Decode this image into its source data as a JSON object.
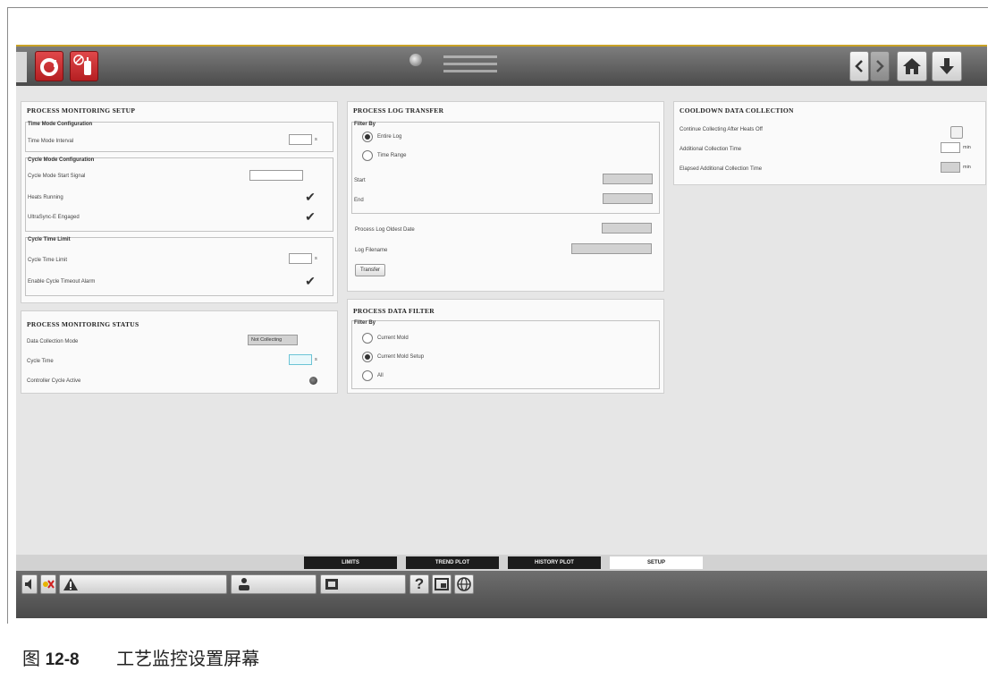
{
  "tabs": [
    "LIMITS",
    "TREND PLOT",
    "HISTORY PLOT",
    "SETUP"
  ],
  "active_tab": "SETUP",
  "setup": {
    "title": "PROCESS MONITORING SETUP",
    "time_mode_group": "Time Mode Configuration",
    "time_mode_interval_label": "Time Mode Interval",
    "time_mode_interval_unit": "s",
    "cycle_mode_group": "Cycle Mode Configuration",
    "cycle_mode_start_signal_label": "Cycle Mode Start Signal",
    "heats_running_label": "Heats Running",
    "ultrasync_label": "UltraSync-E Engaged",
    "cycle_time_limit_group": "Cycle Time Limit",
    "cycle_time_limit_label": "Cycle Time Limit",
    "cycle_time_limit_unit": "s",
    "cycle_timeout_alarm_label": "Enable Cycle Timeout Alarm"
  },
  "status": {
    "title": "PROCESS MONITORING STATUS",
    "data_collection_mode_label": "Data Collection Mode",
    "data_collection_mode_value": "Not Collecting",
    "cycle_time_label": "Cycle Time",
    "cycle_time_unit": "s",
    "controller_cycle_active_label": "Controller Cycle Active"
  },
  "log_transfer": {
    "title": "PROCESS LOG TRANSFER",
    "filter_by": "Filter By",
    "entire_log": "Entire Log",
    "time_range": "Time Range",
    "selected": "entire_log",
    "start_label": "Start",
    "end_label": "End",
    "oldest_date_label": "Process Log Oldest Date",
    "log_filename_label": "Log Filename",
    "transfer_button": "Transfer"
  },
  "data_filter": {
    "title": "PROCESS DATA FILTER",
    "filter_by": "Filter By",
    "current_mold": "Current Mold",
    "current_mold_setup": "Current Mold Setup",
    "all": "All",
    "selected": "current_mold_setup"
  },
  "cooldown": {
    "title": "COOLDOWN DATA COLLECTION",
    "continue_label": "Continue Collecting After Heats Off",
    "additional_time_label": "Additional Collection Time",
    "additional_time_unit": "min",
    "elapsed_time_label": "Elapsed Additional Collection Time",
    "elapsed_time_unit": "min"
  },
  "caption": {
    "prefix": "图",
    "number": "12-8",
    "text": "工艺监控设置屏幕"
  },
  "colors": {
    "accent": "#c9a227",
    "red_button": "#c8282b",
    "panel_bg": "#fafafa",
    "screen_bg": "#e6e6e6"
  }
}
